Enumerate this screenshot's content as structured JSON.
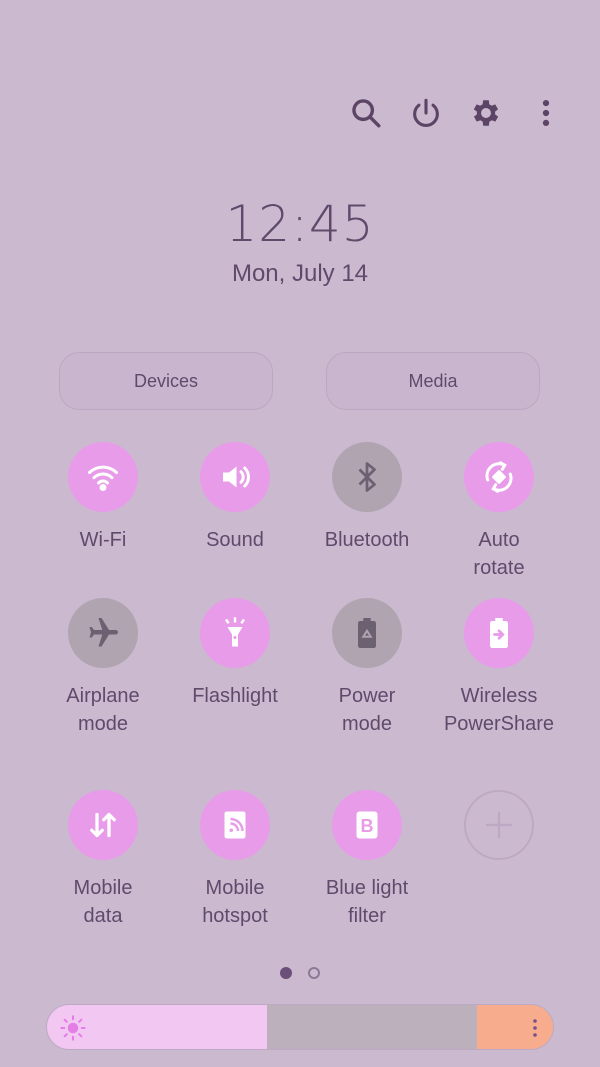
{
  "header": {
    "icons": [
      "search-icon",
      "power-icon",
      "settings-icon",
      "more-options-icon"
    ]
  },
  "clock": {
    "time": "12:45",
    "date": "Mon, July 14"
  },
  "pills": {
    "devices": "Devices",
    "media": "Media"
  },
  "tiles": [
    {
      "label": "Wi-Fi",
      "icon": "wifi-icon",
      "state": "on"
    },
    {
      "label": "Sound",
      "icon": "sound-icon",
      "state": "on"
    },
    {
      "label": "Bluetooth",
      "icon": "bluetooth-icon",
      "state": "off"
    },
    {
      "label": "Auto\nrotate",
      "icon": "auto-rotate-icon",
      "state": "on"
    },
    {
      "label": "Airplane\nmode",
      "icon": "airplane-icon",
      "state": "off"
    },
    {
      "label": "Flashlight",
      "icon": "flashlight-icon",
      "state": "on"
    },
    {
      "label": "Power\nmode",
      "icon": "battery-recycle-icon",
      "state": "off"
    },
    {
      "label": "Wireless\nPowerShare",
      "icon": "powershare-icon",
      "state": "on"
    },
    {
      "label": "Mobile\ndata",
      "icon": "mobile-data-icon",
      "state": "on"
    },
    {
      "label": "Mobile\nhotspot",
      "icon": "hotspot-icon",
      "state": "on"
    },
    {
      "label": "Blue light\nfilter",
      "icon": "blue-light-filter-icon",
      "state": "on"
    },
    {
      "label": "",
      "icon": "add-icon",
      "state": "add"
    }
  ],
  "pagination": {
    "pages": 2,
    "current": 1
  },
  "brightness": {
    "level": 0.43,
    "icon": "sun-icon",
    "menu_icon": "more-vertical-icon"
  },
  "colors": {
    "background": "#cbbacf",
    "tile_on": "#e89be9",
    "tile_off": "#afa4b0",
    "text": "#5f4a6c",
    "brightness_fill": "#f2c8f3",
    "brightness_end": "#f7ad8d"
  }
}
